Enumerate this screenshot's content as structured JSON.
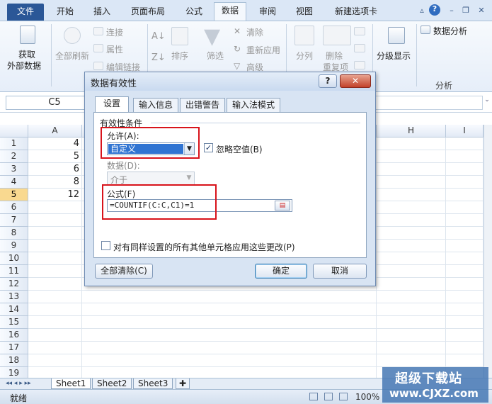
{
  "tabs": {
    "file": "文件",
    "home": "开始",
    "insert": "插入",
    "page_layout": "页面布局",
    "formulas": "公式",
    "data": "数据",
    "review": "审阅",
    "view": "视图",
    "new_tab": "新建选项卡"
  },
  "ribbon": {
    "get_external": "获取",
    "get_external2": "外部数据",
    "refresh_all": "全部刷新",
    "connections": "连接",
    "properties": "属性",
    "edit_links": "编辑链接",
    "sort": "排序",
    "filter": "筛选",
    "clear": "清除",
    "reapply": "重新应用",
    "advanced": "高级",
    "text_to_columns": "分列",
    "remove_dup": "删除",
    "remove_dup2": "重复项",
    "outline": "分级显示",
    "analysis": "数据分析",
    "analysis_group": "分析"
  },
  "formula_bar": {
    "name_box": "C5"
  },
  "grid": {
    "columns": [
      "A",
      "H",
      "I"
    ],
    "rows": [
      "1",
      "2",
      "3",
      "4",
      "5",
      "6",
      "7",
      "8",
      "9",
      "10",
      "11",
      "12",
      "13",
      "14",
      "15",
      "16",
      "17",
      "18",
      "19"
    ],
    "a_values": [
      "4",
      "5",
      "6",
      "8",
      "12"
    ],
    "selected_row": "5"
  },
  "sheets": [
    "Sheet1",
    "Sheet2",
    "Sheet3"
  ],
  "status": {
    "ready": "就绪",
    "zoom": "100%"
  },
  "watermark": {
    "cn": "超级下载站",
    "url": "www.CJXZ.com"
  },
  "dialog": {
    "title": "数据有效性",
    "help": "?",
    "close": "✕",
    "tabs": [
      "设置",
      "输入信息",
      "出错警告",
      "输入法模式"
    ],
    "criteria_title": "有效性条件",
    "allow_label": "允许(A):",
    "allow_value": "自定义",
    "ignore_blank": "忽略空值(B)",
    "data_label": "数据(D):",
    "data_value": "介于",
    "formula_label": "公式(F)",
    "formula_value": "=COUNTIF(C:C,C1)=1",
    "apply_all": "对有同样设置的所有其他单元格应用这些更改(P)",
    "clear_all": "全部清除(C)",
    "ok": "确定",
    "cancel": "取消"
  }
}
